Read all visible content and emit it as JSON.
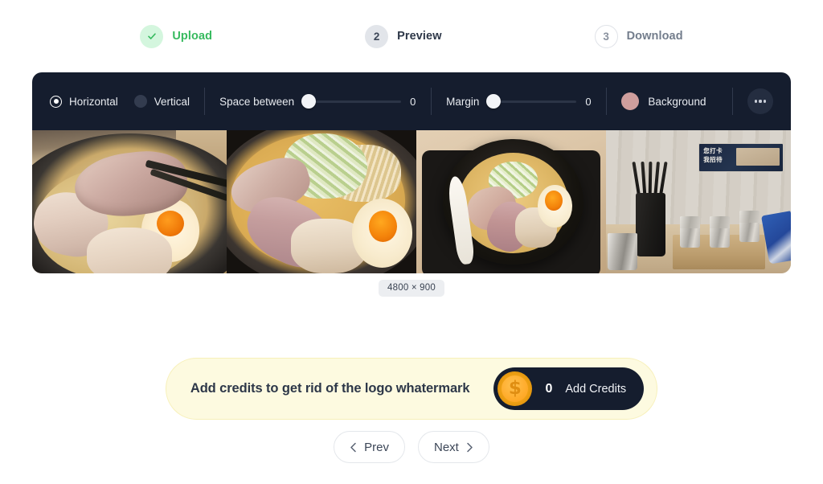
{
  "stepper": {
    "steps": [
      {
        "badge": "check-icon",
        "label": "Upload",
        "state": "done"
      },
      {
        "badge": "2",
        "label": "Preview",
        "state": "current"
      },
      {
        "badge": "3",
        "label": "Download",
        "state": "upcoming"
      }
    ]
  },
  "toolbar": {
    "orientation": {
      "horizontal_label": "Horizontal",
      "vertical_label": "Vertical",
      "selected": "Horizontal"
    },
    "space_between": {
      "label": "Space between",
      "value": "0"
    },
    "margin": {
      "label": "Margin",
      "value": "0"
    },
    "background": {
      "label": "Background",
      "color": "#cf9e9d"
    },
    "more_button": "more-options-icon"
  },
  "canvas": {
    "dimensions_label": "4800 × 900",
    "images": [
      {
        "alt": "ramen-closeup-chashu"
      },
      {
        "alt": "ramen-top-down"
      },
      {
        "alt": "ramen-bowl-on-table"
      },
      {
        "alt": "restaurant-counter"
      }
    ],
    "sign_text": "您打卡\n我招待"
  },
  "credits_banner": {
    "message": "Add credits to get rid of the logo whatermark",
    "coin_symbol": "$",
    "credit_count": "0",
    "button_label": "Add Credits",
    "background_color": "#fdfae0",
    "button_color": "#151d2e"
  },
  "navigation": {
    "prev_label": "Prev",
    "next_label": "Next"
  }
}
